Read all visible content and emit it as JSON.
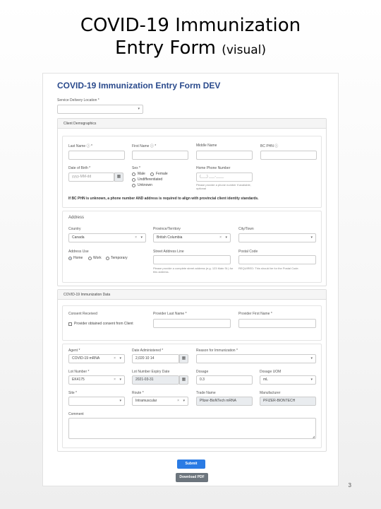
{
  "slide": {
    "title_line1": "COVID-19 Immunization",
    "title_line2": "Entry Form ",
    "title_suffix": "(visual)",
    "page_number": "3"
  },
  "form": {
    "title": "COVID-19 Immunization Entry Form DEV",
    "service_location_label": "Service Delivery Location *",
    "service_location_value": "",
    "client_demographics": {
      "heading": "Client Demographics",
      "last_name_label": "Last Name ⓘ *",
      "first_name_label": "First Name ⓘ *",
      "middle_name_label": "Middle Name",
      "bc_phn_label": "BC PHN ⓘ",
      "dob_label": "Date of Birth *",
      "dob_placeholder": "yyyy-MM-dd",
      "sex_label": "Sex *",
      "sex_options": [
        "Male",
        "Female",
        "Undifferentiated",
        "Unknown"
      ],
      "phone_label": "Home Phone Number",
      "phone_placeholder": "(___) ___-____",
      "phone_help": "Please provide a phone number if available, optional",
      "phn_note": "If BC PHN is unknown, a phone number AND address is required to align with provincial client identity standards."
    },
    "address": {
      "heading": "Address",
      "country_label": "Country",
      "country_value": "Canada",
      "province_label": "Province/Territory",
      "province_value": "British Columbia",
      "city_label": "City/Town",
      "city_value": "",
      "address_use_label": "Address Use",
      "address_use_options": [
        "Home",
        "Work",
        "Temporary"
      ],
      "street_label": "Street Address Line",
      "street_help": "Please provide a complete street address (e.g. 123 Main St.) for this address.",
      "postal_label": "Postal Code",
      "postal_help": "REQUIRED: This should be for the Postal Code."
    },
    "immunization": {
      "heading": "COVID-19 Immunization Data",
      "consent_heading": "Consent Received",
      "consent_checkbox_label": "Provider obtained consent from Client",
      "provider_last_label": "Provider Last Name *",
      "provider_first_label": "Provider First Name *",
      "agent_label": "Agent *",
      "agent_value": "COVID-19 mRNA",
      "date_admin_label": "Date Administered *",
      "date_admin_value": "2,020 10 14",
      "reason_label": "Reason for Immunization *",
      "reason_value": "",
      "lot_label": "Lot Number *",
      "lot_value": "EK4175",
      "lot_expiry_label": "Lot Number Expiry Date",
      "lot_expiry_value": "2021-03-31",
      "dosage_label": "Dosage",
      "dosage_value": "0.3",
      "dosage_uom_label": "Dosage UOM",
      "dosage_uom_value": "mL",
      "site_label": "Site *",
      "site_value": "",
      "route_label": "Route *",
      "route_value": "Intramuscular",
      "trade_label": "Trade Name",
      "trade_value": "Pfizer-BioNTech mRNA",
      "manufacturer_label": "Manufacturer",
      "manufacturer_value": "PFIZER-BIONTECH",
      "comment_label": "Comment"
    },
    "submit_label": "Submit",
    "download_label": "Download PDF"
  }
}
